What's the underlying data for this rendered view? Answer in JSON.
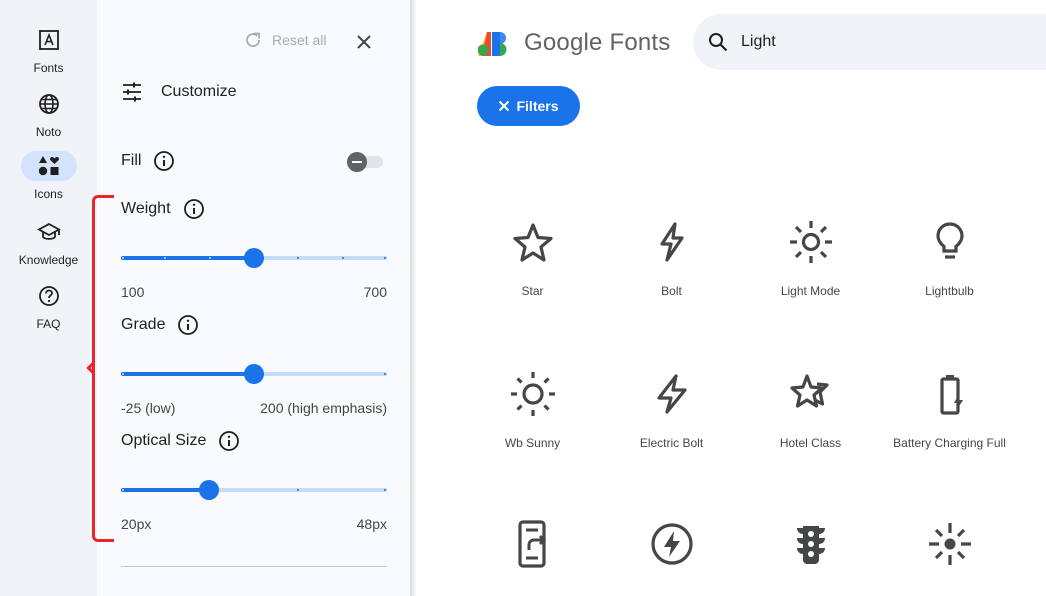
{
  "rail": {
    "items": [
      {
        "label": "Fonts",
        "icon": "font-icon"
      },
      {
        "label": "Noto",
        "icon": "globe-icon"
      },
      {
        "label": "Icons",
        "icon": "shapes-icon",
        "active": true
      },
      {
        "label": "Knowledge",
        "icon": "school-icon"
      },
      {
        "label": "FAQ",
        "icon": "help-icon"
      }
    ]
  },
  "panel": {
    "reset_label": "Reset all",
    "title": "Customize",
    "fill_label": "Fill",
    "fill_on": false,
    "weight": {
      "label": "Weight",
      "min": "100",
      "max": "700",
      "value_fraction": 0.5
    },
    "grade": {
      "label": "Grade",
      "min": "-25 (low)",
      "max": "200 (high emphasis)",
      "value_fraction": 0.5
    },
    "optical_size": {
      "label": "Optical Size",
      "min": "20px",
      "max": "48px",
      "value_fraction": 0.33
    }
  },
  "header": {
    "logo_text": "Google Fonts",
    "search_value": "Light",
    "filters_label": "Filters"
  },
  "colors": {
    "accent": "#1a73e8",
    "annotation": "#e8262b",
    "rail_bg": "#f0f4f9"
  },
  "grid": {
    "icons": [
      {
        "name": "Star",
        "icon": "star-icon"
      },
      {
        "name": "Bolt",
        "icon": "bolt-icon"
      },
      {
        "name": "Light Mode",
        "icon": "light-mode-icon"
      },
      {
        "name": "Lightbulb",
        "icon": "lightbulb-icon"
      },
      {
        "name": "Wb Sunny",
        "icon": "wb-sunny-icon"
      },
      {
        "name": "Electric Bolt",
        "icon": "electric-bolt-icon"
      },
      {
        "name": "Hotel Class",
        "icon": "hotel-class-icon"
      },
      {
        "name": "Battery Charging Full",
        "icon": "battery-charging-icon"
      },
      {
        "name": "",
        "icon": "mobile-share-icon"
      },
      {
        "name": "",
        "icon": "offline-bolt-icon"
      },
      {
        "name": "",
        "icon": "traffic-icon"
      },
      {
        "name": "",
        "icon": "highlight-icon"
      }
    ]
  }
}
